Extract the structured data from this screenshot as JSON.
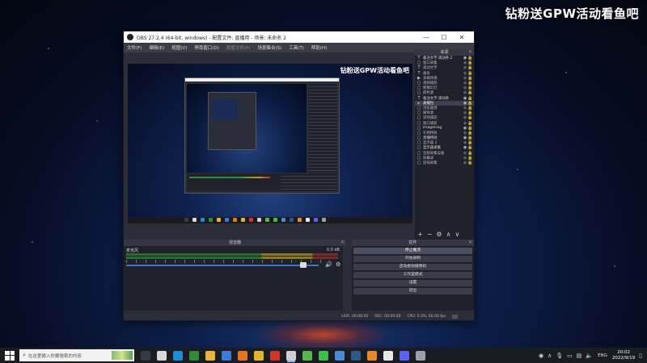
{
  "watermark": "钻粉送GPW活动看鱼吧",
  "obs": {
    "title": "OBS 27.2.4 (64-bit, windows) - 配置文件: 直播用 - 场景: 未命名 2",
    "window_controls": {
      "minimize": "—",
      "maximize": "☐",
      "close": "✕"
    },
    "menu": [
      {
        "label": "文件(F)",
        "enabled": true
      },
      {
        "label": "编辑(E)",
        "enabled": true
      },
      {
        "label": "视图(V)",
        "enabled": true
      },
      {
        "label": "停靠窗口(D)",
        "enabled": true
      },
      {
        "label": "配置文件(P)",
        "enabled": false
      },
      {
        "label": "场景集合(S)",
        "enabled": true
      },
      {
        "label": "工具(T)",
        "enabled": true
      },
      {
        "label": "帮助(H)",
        "enabled": true
      }
    ],
    "preview_watermark": "钻粉送GPW活动看鱼吧",
    "sources": {
      "title": "来源",
      "items": [
        {
          "icon": "T",
          "name": "备注文字·滚动条 2",
          "visible": true
        },
        {
          "icon": "▢",
          "name": "窗口采集",
          "visible": false
        },
        {
          "icon": "T",
          "name": "滚动文字",
          "visible": false
        },
        {
          "icon": "T",
          "name": "备份",
          "visible": false
        },
        {
          "icon": "▶",
          "name": "多媒体源",
          "visible": false
        },
        {
          "icon": "▢",
          "name": "视频捕获",
          "visible": false
        },
        {
          "icon": "▢",
          "name": "图像幻灯",
          "visible": false
        },
        {
          "icon": "▢",
          "name": "颜色源",
          "visible": false
        },
        {
          "icon": "T",
          "name": "备注文字·滚动条",
          "visible": true
        },
        {
          "icon": "▸",
          "name": "表情包",
          "visible": true
        },
        {
          "icon": "▢",
          "name": "浏览器源",
          "visible": false
        },
        {
          "icon": "▢",
          "name": "媒体源",
          "visible": false
        },
        {
          "icon": "▢",
          "name": "游戏捕获",
          "visible": false
        },
        {
          "icon": "▢",
          "name": "窗口捕获",
          "visible": false
        },
        {
          "icon": "▢",
          "name": "ImageFrog",
          "visible": true
        },
        {
          "icon": "▢",
          "name": "礼物特效",
          "visible": false
        },
        {
          "icon": "▢",
          "name": "直播特效",
          "visible": true
        },
        {
          "icon": "▢",
          "name": "显示器 2",
          "visible": false
        },
        {
          "icon": "▢",
          "name": "显示器采集",
          "visible": true
        },
        {
          "icon": "▢",
          "name": "音频采集设备",
          "visible": false
        },
        {
          "icon": "▢",
          "name": "屏幕录",
          "visible": false
        },
        {
          "icon": "▢",
          "name": "游戏采集",
          "visible": false
        }
      ],
      "toolbar": [
        "+",
        "−",
        "⚙",
        "∧",
        "∨"
      ]
    },
    "mixer": {
      "title": "混音器",
      "track_name": "麦克风",
      "track_db": "0.0 dB",
      "volume_level": 0.92
    },
    "controls": {
      "title": "控件",
      "buttons": [
        {
          "label": "停止推流",
          "active": true
        },
        {
          "label": "开始录制",
          "active": false
        },
        {
          "label": "启动虚拟摄像机",
          "active": false
        },
        {
          "label": "工作室模式",
          "active": false
        },
        {
          "label": "设置",
          "active": false
        },
        {
          "label": "退出",
          "active": false
        }
      ]
    },
    "status": {
      "dropped": "LIVE: 00:00:00",
      "rec": "REC: 00:00:00",
      "cpu": "CPU: 0.3%, 60.00 fps"
    }
  },
  "taskbar": {
    "search_placeholder": "在这里输入你要搜索的内容",
    "apps": [
      {
        "name": "task-view",
        "color": "#3a3a45"
      },
      {
        "name": "obs",
        "color": "#d8d8d8"
      },
      {
        "name": "edge",
        "color": "#1f8dd6"
      },
      {
        "name": "xbox",
        "color": "#2f8a3a"
      },
      {
        "name": "folder",
        "color": "#e9b23d"
      },
      {
        "name": "store",
        "color": "#3a7bd5"
      },
      {
        "name": "app-orange",
        "color": "#e27428"
      },
      {
        "name": "chrome",
        "color": "#e0b52b"
      },
      {
        "name": "app-red",
        "color": "#d0342c"
      },
      {
        "name": "obs-active",
        "color": "#cfcfcf",
        "active": true
      },
      {
        "name": "app-green",
        "color": "#57b947"
      },
      {
        "name": "wechat",
        "color": "#3fbf4a"
      },
      {
        "name": "app-blue",
        "color": "#4a88d8"
      },
      {
        "name": "steam",
        "color": "#2b5a86"
      },
      {
        "name": "app-orange2",
        "color": "#e68a2c"
      },
      {
        "name": "app-white",
        "color": "#e8e8e8"
      },
      {
        "name": "discord",
        "color": "#5865f2"
      },
      {
        "name": "app-gear",
        "color": "#9aa0aa"
      }
    ],
    "lang": "ENG",
    "time": "20:02",
    "date": "2022/9/19"
  }
}
